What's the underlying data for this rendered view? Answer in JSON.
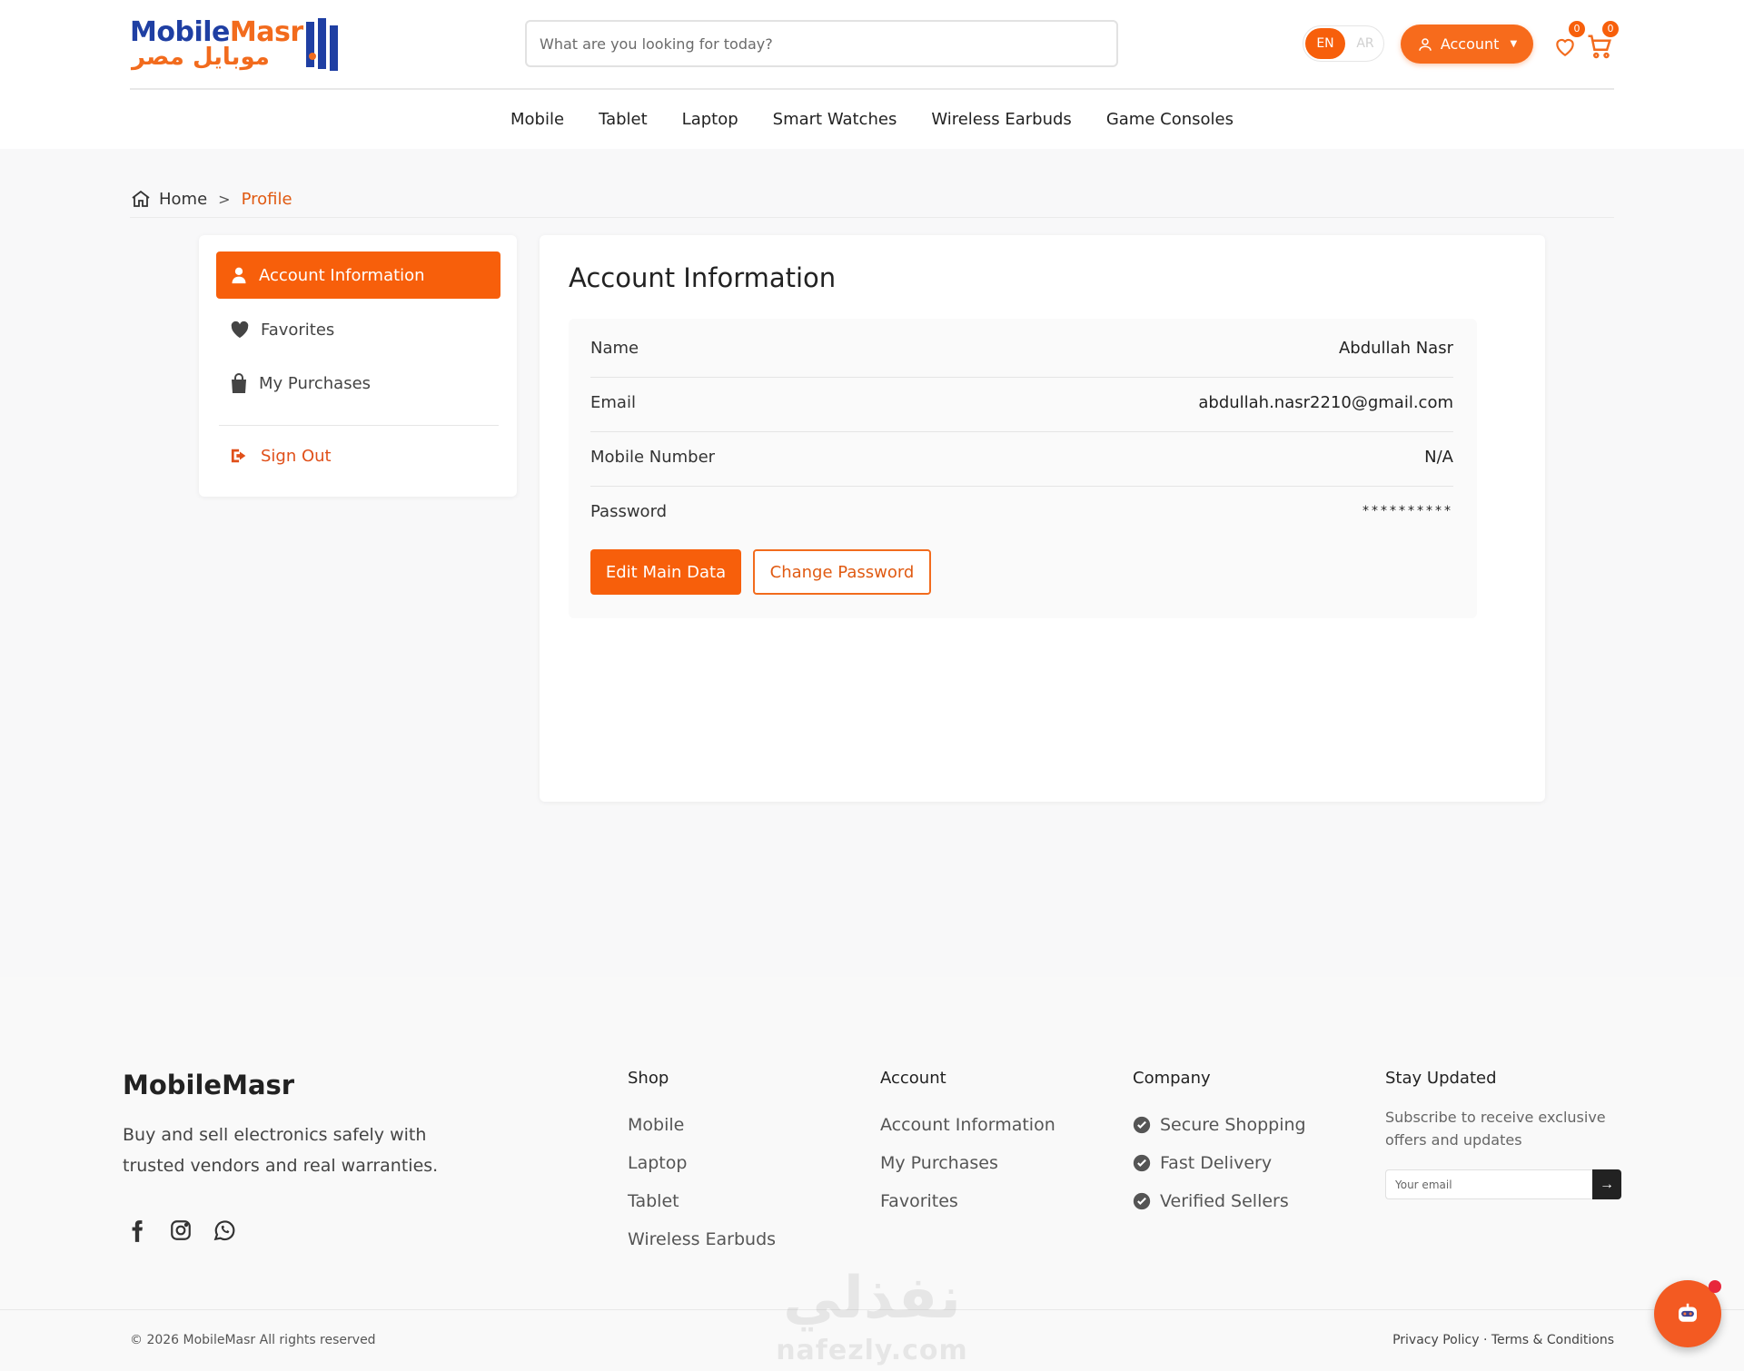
{
  "header": {
    "logo_en_1": "Mobile",
    "logo_en_2": "Masr",
    "logo_ar": "موبايل مصر",
    "search_placeholder": "What are you looking for today?",
    "lang_en": "EN",
    "lang_ar": "AR",
    "account_label": "Account",
    "wishlist_count": "0",
    "cart_count": "0"
  },
  "nav": {
    "items": [
      "Mobile",
      "Tablet",
      "Laptop",
      "Smart Watches",
      "Wireless Earbuds",
      "Game Consoles"
    ]
  },
  "breadcrumb": {
    "home": "Home",
    "current": "Profile"
  },
  "sidebar": {
    "items": [
      {
        "label": "Account Information",
        "icon": "user-icon"
      },
      {
        "label": "Favorites",
        "icon": "heart-icon"
      },
      {
        "label": "My Purchases",
        "icon": "shopping-bag-icon"
      },
      {
        "label": "Sign Out",
        "icon": "sign-out-icon"
      }
    ]
  },
  "account": {
    "title": "Account Information",
    "fields": [
      {
        "label": "Name",
        "value": "Abdullah Nasr"
      },
      {
        "label": "Email",
        "value": "abdullah.nasr2210@gmail.com"
      },
      {
        "label": "Mobile Number",
        "value": "N/A"
      },
      {
        "label": "Password",
        "value": "**********"
      }
    ],
    "edit_label": "Edit Main Data",
    "change_password_label": "Change Password"
  },
  "footer": {
    "brand": "MobileMasr",
    "description": "Buy and sell electronics safely with trusted vendors and real warranties.",
    "shop": {
      "title": "Shop",
      "links": [
        "Mobile",
        "Laptop",
        "Tablet",
        "Wireless Earbuds"
      ]
    },
    "account": {
      "title": "Account",
      "links": [
        "Account Information",
        "My Purchases",
        "Favorites"
      ]
    },
    "company": {
      "title": "Company",
      "links": [
        "Secure Shopping",
        "Fast Delivery",
        "Verified Sellers"
      ]
    },
    "newsletter": {
      "title": "Stay Updated",
      "text": "Subscribe to receive exclusive offers and updates",
      "placeholder": "Your email",
      "submit": "→"
    },
    "copyright": "© 2026 MobileMasr All rights reserved",
    "legal": "Privacy Policy · Terms & Conditions"
  },
  "watermark": {
    "ar": "نفذلي",
    "en": "nafezly.com"
  },
  "colors": {
    "accent": "#f75f0b",
    "brand_blue": "#1f3fa3"
  }
}
